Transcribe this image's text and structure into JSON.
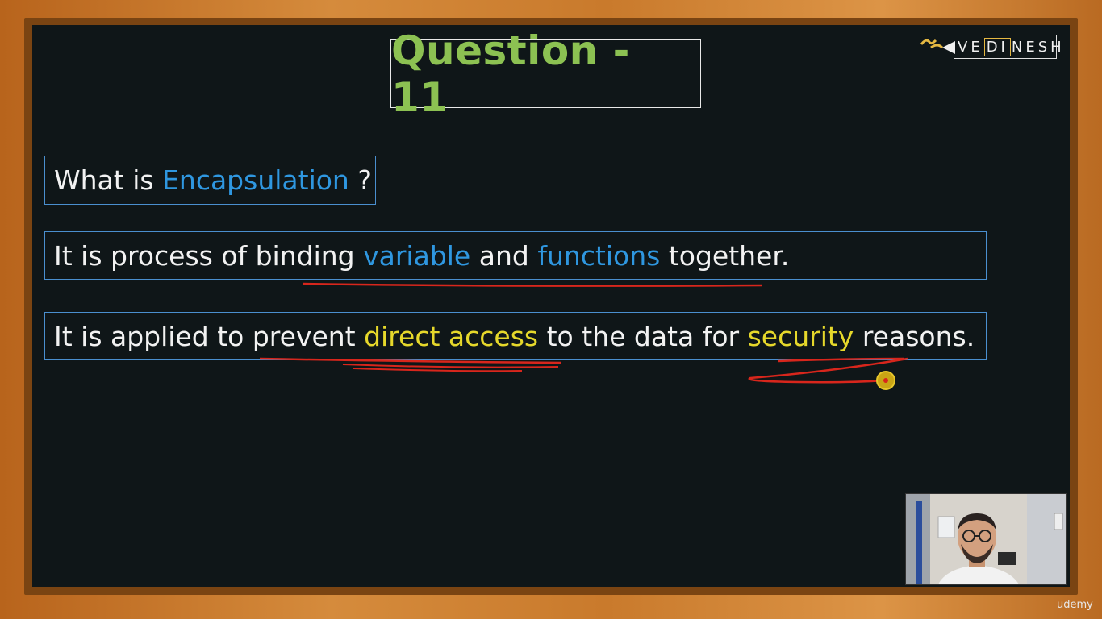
{
  "slide": {
    "title": "Question - 11",
    "question": {
      "prefix": "What is ",
      "highlight": "Encapsulation",
      "suffix": " ?"
    },
    "answer1": {
      "part1": "It is process of binding ",
      "hl1": "variable",
      "part2": " and ",
      "hl2": "functions",
      "part3": " together."
    },
    "answer2": {
      "part1": "It is applied to prevent ",
      "hl1": "direct access",
      "part2": " to the data for ",
      "hl2": "security",
      "part3": " reasons."
    }
  },
  "logo": {
    "left": "VE",
    "middle": "DI",
    "right": "NESH"
  },
  "watermark": "ūdemy",
  "colors": {
    "title_green": "#8cc152",
    "keyword_blue": "#2f97e0",
    "keyword_yellow": "#e6d82b",
    "annotation_red": "#d8261c",
    "board": "#0f1618",
    "frame_wood": "#c9782a"
  },
  "icons": {
    "logo_mark": "pen-nib-icon",
    "pointer": "laser-pointer-icon"
  }
}
